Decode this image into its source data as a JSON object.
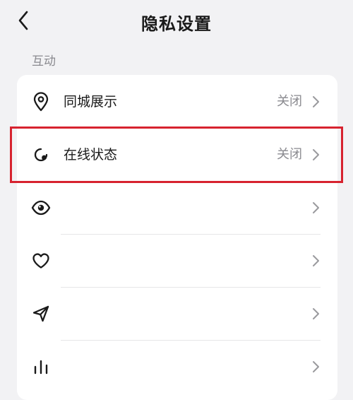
{
  "header": {
    "title": "隐私设置"
  },
  "section": {
    "label": "互动"
  },
  "rows": [
    {
      "label": "同城展示",
      "value": "关闭",
      "icon": "location-pin-icon"
    },
    {
      "label": "在线状态",
      "value": "关闭",
      "icon": "online-status-icon"
    },
    {
      "label": "",
      "value": "",
      "icon": "eye-icon"
    },
    {
      "label": "",
      "value": "",
      "icon": "heart-icon"
    },
    {
      "label": "",
      "value": "",
      "icon": "send-icon"
    },
    {
      "label": "",
      "value": "",
      "icon": "bar-chart-icon"
    }
  ],
  "colors": {
    "highlight": "#d7232f",
    "background": "#f2f2f4",
    "muted_text": "#8a8a8f"
  }
}
